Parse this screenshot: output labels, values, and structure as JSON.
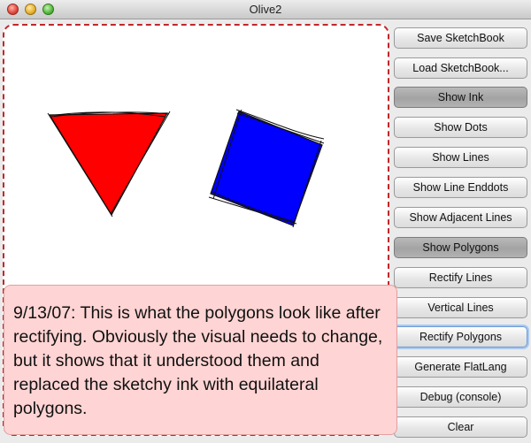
{
  "window": {
    "title": "Olive2"
  },
  "buttons": [
    {
      "label": "Save SketchBook",
      "state": "normal"
    },
    {
      "label": "Load SketchBook...",
      "state": "normal"
    },
    {
      "label": "Show Ink",
      "state": "pressed"
    },
    {
      "label": "Show Dots",
      "state": "normal"
    },
    {
      "label": "Show Lines",
      "state": "normal"
    },
    {
      "label": "Show Line Enddots",
      "state": "normal"
    },
    {
      "label": "Show Adjacent Lines",
      "state": "normal"
    },
    {
      "label": "Show Polygons",
      "state": "pressed"
    },
    {
      "label": "Rectify Lines",
      "state": "normal"
    },
    {
      "label": "Vertical Lines",
      "state": "normal"
    },
    {
      "label": "Rectify Polygons",
      "state": "focused"
    },
    {
      "label": "Generate FlatLang",
      "state": "normal"
    },
    {
      "label": "Debug (console)",
      "state": "normal"
    },
    {
      "label": "Clear",
      "state": "normal"
    }
  ],
  "note": {
    "text": "9/13/07: This is what the polygons look like after rectifying. Obviously the visual needs to change, but it shows that it understood them and replaced the sketchy ink with equilateral polygons."
  },
  "canvas": {
    "shapes": [
      {
        "name": "triangle",
        "color": "#ff0000"
      },
      {
        "name": "square",
        "color": "#0000ff"
      }
    ]
  }
}
